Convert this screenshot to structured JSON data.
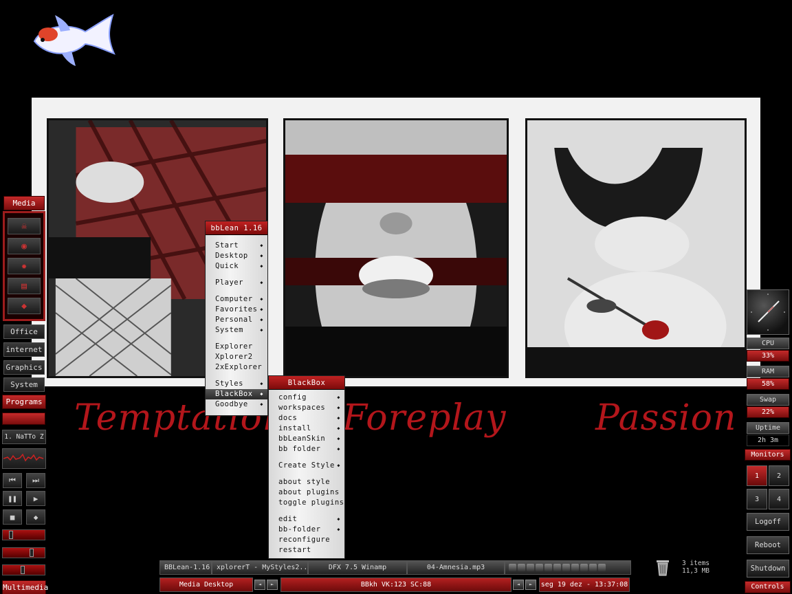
{
  "left_panel": {
    "media_title": "Media",
    "media_icons": [
      "skull-icon",
      "player-icon",
      "flame-icon",
      "film-icon",
      "folder-icon"
    ],
    "buttons": [
      "Office",
      "internet",
      "Graphics",
      "System"
    ],
    "programs": "Programs",
    "track": "1. NaTTo Z",
    "multimedia": "Multimedia",
    "player_controls": [
      "previous-icon",
      "next-icon",
      "pause-icon",
      "play-icon",
      "stop-icon",
      "eject-icon"
    ],
    "sliders": [
      0.15,
      0.65,
      0.45
    ]
  },
  "wallpaper": {
    "captions": [
      "Temptation",
      "Foreplay",
      "Passion"
    ]
  },
  "menu": {
    "title": "bbLean 1.16",
    "items": [
      {
        "label": "Start",
        "sub": true
      },
      {
        "label": "Desktop",
        "sub": true
      },
      {
        "label": "Quick",
        "sub": true
      },
      {
        "gap": true
      },
      {
        "label": "Player",
        "sub": true
      },
      {
        "gap": true
      },
      {
        "label": "Computer",
        "sub": true
      },
      {
        "label": "Favorites",
        "sub": true
      },
      {
        "label": "Personal",
        "sub": true
      },
      {
        "label": "System",
        "sub": true
      },
      {
        "gap": true
      },
      {
        "label": "Explorer",
        "sub": false
      },
      {
        "label": "Xplorer2",
        "sub": false
      },
      {
        "label": "2xExplorer",
        "sub": false
      },
      {
        "gap": true
      },
      {
        "label": "Styles",
        "sub": true
      },
      {
        "label": "BlackBox",
        "sub": true,
        "selected": true
      },
      {
        "label": "Goodbye",
        "sub": true
      }
    ]
  },
  "submenu": {
    "title": "BlackBox",
    "items": [
      {
        "label": "config",
        "sub": true
      },
      {
        "label": "workspaces",
        "sub": true
      },
      {
        "label": "docs",
        "sub": true
      },
      {
        "label": "install",
        "sub": true
      },
      {
        "label": "bbLeanSkin",
        "sub": true
      },
      {
        "label": "bb folder",
        "sub": true
      },
      {
        "gap": true
      },
      {
        "label": "Create Style",
        "sub": true
      },
      {
        "gap": true
      },
      {
        "label": "about style",
        "sub": false
      },
      {
        "label": "about plugins",
        "sub": false
      },
      {
        "label": "toggle plugins",
        "sub": false
      },
      {
        "gap": true
      },
      {
        "label": "edit",
        "sub": true
      },
      {
        "label": "bb-folder",
        "sub": true
      },
      {
        "label": "reconfigure",
        "sub": false
      },
      {
        "label": "restart",
        "sub": false
      }
    ]
  },
  "right_panel": {
    "monitors": [
      {
        "label": "CPU",
        "value": "33%"
      },
      {
        "label": "RAM",
        "value": "58%"
      },
      {
        "label": "Swap",
        "value": "22%"
      },
      {
        "label": "Uptime",
        "value": "2h 3m"
      }
    ],
    "monitors_title": "Monitors",
    "workspaces": [
      "1",
      "2",
      "3",
      "4"
    ],
    "active_workspace": "1",
    "logoff": "Logoff",
    "reboot": "Reboot",
    "shutdown": "Shutdown",
    "controls": "Controls"
  },
  "taskbar": {
    "tasks": [
      "BBLean-1.16",
      "xplorerT - MyStyles2...",
      "DFX 7.5 Winamp",
      "04-Amnesia.mp3"
    ],
    "workspace_name": "Media Desktop",
    "status": "BBkh VK:123 SC:88",
    "datetime": "seg 19 dez - 13:37:08"
  },
  "trash": {
    "items": "3 items",
    "size": "11,3 MB"
  },
  "colors": {
    "accent": "#b32020",
    "menu_bg": "#e6e6e6",
    "caption": "#b3161b"
  }
}
